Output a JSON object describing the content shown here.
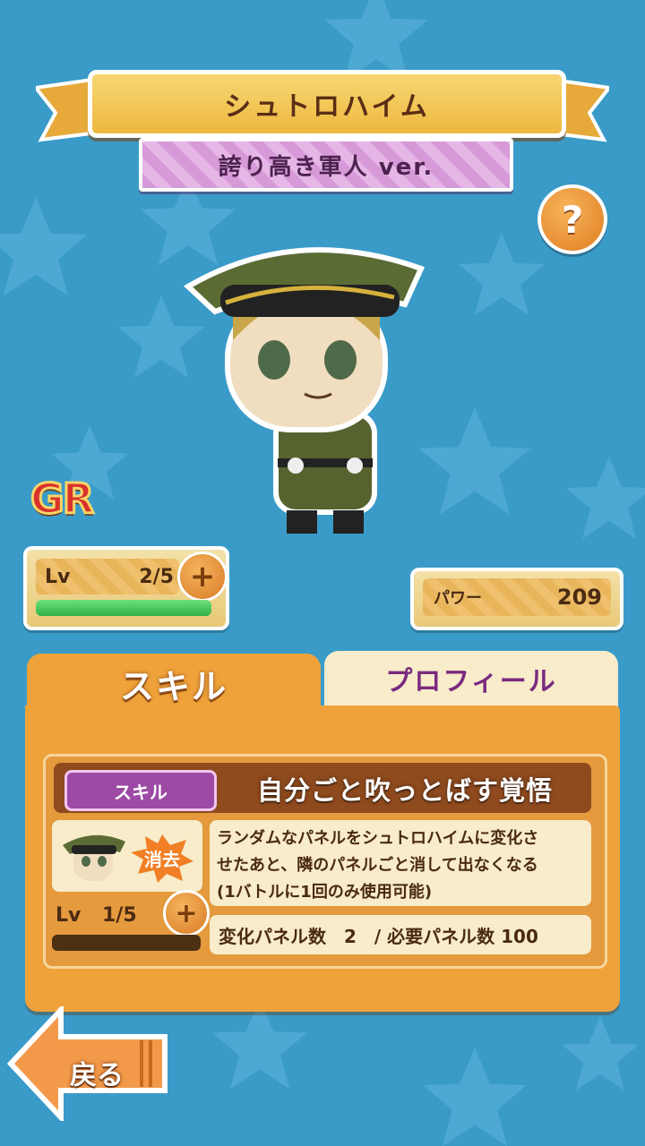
{
  "title": {
    "name": "シュトロハイム",
    "version": "誇り高き軍人 ver."
  },
  "help_icon": "question-mark",
  "rarity": "GR",
  "level": {
    "label": "Lv",
    "value": "2/5",
    "exp_fraction": 1.0
  },
  "power": {
    "label": "パワー",
    "value": "209"
  },
  "tabs": {
    "skill": "スキル",
    "profile": "プロフィール"
  },
  "skill": {
    "tag": "スキル",
    "name": "自分ごと吹っとばす覚悟",
    "badge": "消去",
    "description_1": "ランダムなパネルをシュトロハイムに変化さ",
    "description_2": "せたあと、隣のパネルごと消して出なくなる",
    "description_3": "(1バトルに1回のみ使用可能)",
    "level_label": "Lv",
    "level_value": "1/5",
    "exp_fraction": 0.0,
    "stats": "変化パネル数　2　/ 必要パネル数 100"
  },
  "back_button": "戻る",
  "colors": {
    "background": "#3a9bc9",
    "folder": "#efa23a",
    "accent_purple": "#9d4aa5"
  }
}
